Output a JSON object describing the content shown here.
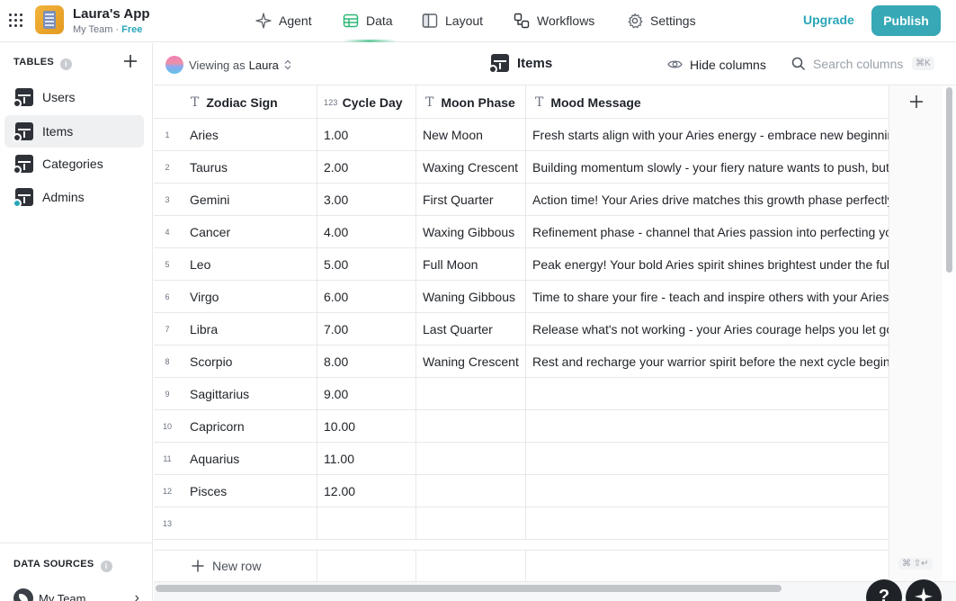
{
  "app": {
    "title": "Laura's App",
    "team": "My Team",
    "separator": "·",
    "plan": "Free"
  },
  "nav": {
    "agent": "Agent",
    "data": "Data",
    "layout": "Layout",
    "workflows": "Workflows",
    "settings": "Settings",
    "active": "Data"
  },
  "actions": {
    "upgrade": "Upgrade",
    "publish": "Publish"
  },
  "sidebar": {
    "tables_heading": "TABLES",
    "info_glyph": "i",
    "items": [
      {
        "label": "Users",
        "icon": "table-icon",
        "active": false
      },
      {
        "label": "Items",
        "icon": "table-icon",
        "active": true
      },
      {
        "label": "Categories",
        "icon": "table-icon",
        "active": false
      },
      {
        "label": "Admins",
        "icon": "table-icon",
        "active": false
      }
    ],
    "data_sources_heading": "DATA SOURCES",
    "source_name": "My Team"
  },
  "toolbar": {
    "viewing_as_prefix": "Viewing as",
    "viewing_as_user": "Laura",
    "table_title": "Items",
    "hide_columns": "Hide columns",
    "search_placeholder": "Search columns",
    "search_shortcut": "⌘K"
  },
  "table": {
    "columns": [
      {
        "label": "Zodiac Sign",
        "type_glyph": "T"
      },
      {
        "label": "Cycle Day",
        "type_glyph": "123"
      },
      {
        "label": "Moon Phase",
        "type_glyph": "T"
      },
      {
        "label": "Mood Message",
        "type_glyph": "T"
      }
    ],
    "rows": [
      {
        "n": "1",
        "sign": "Aries",
        "day": "1.00",
        "moon": "New Moon",
        "msg": "Fresh starts align with your Aries energy - embrace new beginnings"
      },
      {
        "n": "2",
        "sign": "Taurus",
        "day": "2.00",
        "moon": "Waxing Crescent",
        "msg": "Building momentum slowly - your fiery nature wants to push, but"
      },
      {
        "n": "3",
        "sign": "Gemini",
        "day": "3.00",
        "moon": "First Quarter",
        "msg": "Action time! Your Aries drive matches this growth phase perfectly"
      },
      {
        "n": "4",
        "sign": "Cancer",
        "day": "4.00",
        "moon": "Waxing Gibbous",
        "msg": "Refinement phase - channel that Aries passion into perfecting your"
      },
      {
        "n": "5",
        "sign": "Leo",
        "day": "5.00",
        "moon": "Full Moon",
        "msg": "Peak energy! Your bold Aries spirit shines brightest under the full"
      },
      {
        "n": "6",
        "sign": "Virgo",
        "day": "6.00",
        "moon": "Waning Gibbous",
        "msg": "Time to share your fire - teach and inspire others with your Aries"
      },
      {
        "n": "7",
        "sign": "Libra",
        "day": "7.00",
        "moon": "Last Quarter",
        "msg": "Release what's not working - your Aries courage helps you let go"
      },
      {
        "n": "8",
        "sign": "Scorpio",
        "day": "8.00",
        "moon": "Waning Crescent",
        "msg": "Rest and recharge your warrior spirit before the next cycle begins"
      },
      {
        "n": "9",
        "sign": "Sagittarius",
        "day": "9.00",
        "moon": "",
        "msg": ""
      },
      {
        "n": "10",
        "sign": "Capricorn",
        "day": "10.00",
        "moon": "",
        "msg": ""
      },
      {
        "n": "11",
        "sign": "Aquarius",
        "day": "11.00",
        "moon": "",
        "msg": ""
      },
      {
        "n": "12",
        "sign": "Pisces",
        "day": "12.00",
        "moon": "",
        "msg": ""
      },
      {
        "n": "13",
        "sign": "",
        "day": "",
        "moon": "",
        "msg": ""
      }
    ],
    "new_row": "New row",
    "enter_shortcut": "⌘ ⇧↵"
  },
  "floating": {
    "help": "?"
  },
  "colors": {
    "accent": "#36a8b6",
    "accent_text": "#2aa6b8",
    "active_row": "#eef0f2"
  }
}
